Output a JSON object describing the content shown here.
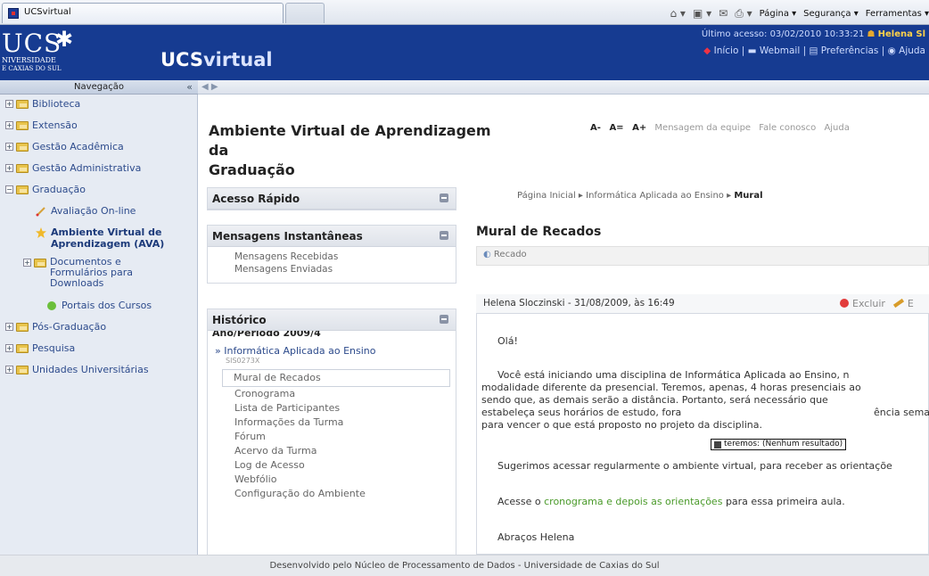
{
  "browser": {
    "tab_title": "UCSvirtual",
    "tools": [
      "Página ▾",
      "Segurança ▾",
      "Ferramentas ▾"
    ]
  },
  "header": {
    "logo_ucs": "UCS",
    "logo_universidade": "NIVERSIDADE",
    "logo_caxias": "E CAXIAS DO SUL",
    "brand_ucs": "UCS",
    "brand_virtual": "virtual",
    "ultimo_acesso": "Último acesso: 03/02/2010 10:33:21",
    "user": "Helena Sl",
    "links": [
      "Início",
      "Webmail",
      "Preferências",
      "Ajuda"
    ]
  },
  "sidebar": {
    "title": "Navegação",
    "collapse": "«",
    "items": [
      {
        "label": "Biblioteca",
        "type": "folder",
        "level": 0,
        "state": "+"
      },
      {
        "label": "Extensão",
        "type": "folder",
        "level": 0,
        "state": "+"
      },
      {
        "label": "Gestão Acadêmica",
        "type": "folder",
        "level": 0,
        "state": "+"
      },
      {
        "label": "Gestão Administrativa",
        "type": "folder",
        "level": 0,
        "state": "+"
      },
      {
        "label": "Graduação",
        "type": "folder",
        "level": 0,
        "state": "-"
      },
      {
        "label": "Avaliação On-line",
        "type": "link",
        "level": 1
      },
      {
        "label": "Ambiente Virtual de Aprendizagem (AVA)",
        "type": "link-active",
        "level": 1
      },
      {
        "label": "Documentos e Formulários para Downloads",
        "type": "folder",
        "level": 1,
        "state": "+"
      },
      {
        "label": "Portais dos Cursos",
        "type": "link",
        "level": 1
      },
      {
        "label": "Pós-Graduação",
        "type": "folder",
        "level": 0,
        "state": "+"
      },
      {
        "label": "Pesquisa",
        "type": "folder",
        "level": 0,
        "state": "+"
      },
      {
        "label": "Unidades Universitárias",
        "type": "folder",
        "level": 0,
        "state": "+"
      }
    ]
  },
  "content": {
    "title_line1": "Ambiente Virtual de Aprendizagem da",
    "title_line2": "Graduação",
    "font_controls": [
      "A-",
      "A=",
      "A+"
    ],
    "top_links": [
      "Mensagem da equipe",
      "Fale conosco",
      "Ajuda"
    ],
    "breadcrumb": [
      "Página Inicial",
      "Informática Aplicada ao Ensino",
      "Mural"
    ]
  },
  "panels": {
    "acesso_rapido": "Acesso Rápido",
    "mensagens": {
      "title": "Mensagens Instantâneas",
      "items": [
        "Mensagens Recebidas",
        "Mensagens Enviadas"
      ]
    },
    "historico": {
      "title": "Histórico",
      "periodo": "Ano/Período 2009/4",
      "disciplina": "Informática Aplicada ao Ensino",
      "codigo": "SIS0273X",
      "active_item": "Mural de Recados",
      "items": [
        "Cronograma",
        "Lista de Participantes",
        "Informações da Turma",
        "Fórum",
        "Acervo da Turma",
        "Log de Acesso",
        "Webfólio",
        "Configuração do Ambiente"
      ]
    }
  },
  "mural": {
    "title": "Mural de Recados",
    "recado_button": "Recado",
    "post": {
      "author_date": "Helena Sloczinski - 31/08/2009, às 16:49",
      "excluir": "Excluir",
      "editar": "E",
      "greeting": "Olá!",
      "p1_line1": "Você está iniciando uma disciplina de Informática Aplicada ao Ensino, n",
      "p1_line2": "modalidade diferente da presencial. Teremos, apenas, 4 horas presenciais ao",
      "p1_line3": "sendo que, as demais serão a distância. Portanto, será necessário que",
      "p1_line4": "estabeleça seus horários de estudo, fora",
      "p1_line4_end": "ência sema",
      "p1_line5": "para vencer o que está proposto no projeto da disciplina.",
      "p2": "Sugerimos acessar regularmente o ambiente virtual, para receber as orientaçõe",
      "p3_pre": "Acesse o",
      "p3_link": "cronograma e depois as orientações",
      "p3_post": "para essa primeira aula.",
      "signature": "Abraços Helena",
      "tooltip": "teremos: (Nenhum resultado)"
    }
  },
  "footer": "Desenvolvido pelo Núcleo de Processamento de Dados - Universidade de Caxias do Sul"
}
